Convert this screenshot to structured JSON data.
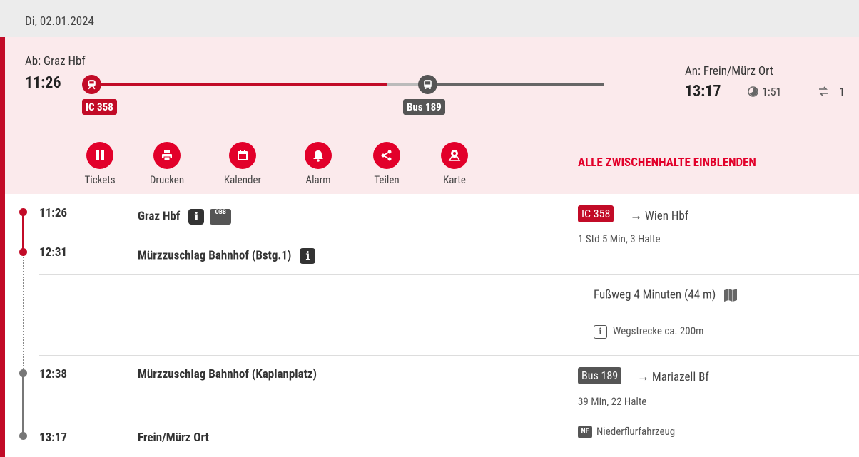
{
  "date": "Di, 02.01.2024",
  "summary": {
    "departure_label": "Ab: Graz Hbf",
    "departure_time": "11:26",
    "arrival_label": "An: Frein/Mürz Ort",
    "arrival_time": "13:17",
    "duration": "1:51",
    "transfers": "1",
    "segments": [
      {
        "label": "IC 358",
        "color": "#c20b27"
      },
      {
        "label": "Bus 189",
        "color": "#555555"
      }
    ],
    "show_stops_label": "ALLE ZWISCHENHALTE EINBLENDEN"
  },
  "actions": [
    {
      "label": "Tickets",
      "icon": "ticket-icon"
    },
    {
      "label": "Drucken",
      "icon": "print-icon"
    },
    {
      "label": "Kalender",
      "icon": "calendar-icon"
    },
    {
      "label": "Alarm",
      "icon": "bell-icon"
    },
    {
      "label": "Teilen",
      "icon": "share-icon"
    },
    {
      "label": "Karte",
      "icon": "map-icon"
    }
  ],
  "legs": {
    "train": {
      "dep_time": "11:26",
      "dep_stop": "Graz Hbf",
      "arr_time": "12:31",
      "arr_stop": "Mürzzuschlag Bahnhof (Bstg.1)",
      "line": "IC 358",
      "direction": "Wien Hbf",
      "info": "1 Std 5 Min, 3 Halte",
      "obb_logo": "ÖBB"
    },
    "walk": {
      "label": "Fußweg 4 Minuten (44 m)",
      "note": "Wegstrecke ca. 200m"
    },
    "bus": {
      "dep_time": "12:38",
      "dep_stop": "Mürzzuschlag Bahnhof (Kaplanplatz)",
      "arr_time": "13:17",
      "arr_stop": "Frein/Mürz Ort",
      "line": "Bus 189",
      "direction": "Mariazell Bf",
      "info": "39 Min, 22 Halte",
      "feature_badge": "NF",
      "feature": "Niederflurfahrzeug"
    }
  },
  "arrow": "→"
}
